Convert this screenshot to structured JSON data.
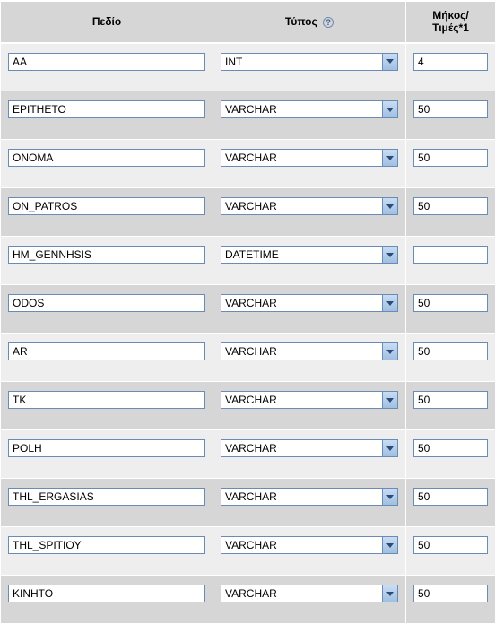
{
  "headers": {
    "field": "Πεδίο",
    "type": "Τύπος",
    "length_line1": "Μήκος/",
    "length_line2": "Τιμές*1"
  },
  "rows": [
    {
      "field": "AA",
      "type": "INT",
      "length": "4"
    },
    {
      "field": "EPITHETO",
      "type": "VARCHAR",
      "length": "50"
    },
    {
      "field": "ONOMA",
      "type": "VARCHAR",
      "length": "50"
    },
    {
      "field": "ON_PATROS",
      "type": "VARCHAR",
      "length": "50"
    },
    {
      "field": "HM_GENNHSIS",
      "type": "DATETIME",
      "length": ""
    },
    {
      "field": "ODOS",
      "type": "VARCHAR",
      "length": "50"
    },
    {
      "field": "AR",
      "type": "VARCHAR",
      "length": "50"
    },
    {
      "field": "TK",
      "type": "VARCHAR",
      "length": "50"
    },
    {
      "field": "POLH",
      "type": "VARCHAR",
      "length": "50"
    },
    {
      "field": "THL_ERGASIAS",
      "type": "VARCHAR",
      "length": "50"
    },
    {
      "field": "THL_SPITIOY",
      "type": "VARCHAR",
      "length": "50"
    },
    {
      "field": "KINHTO",
      "type": "VARCHAR",
      "length": "50"
    }
  ]
}
